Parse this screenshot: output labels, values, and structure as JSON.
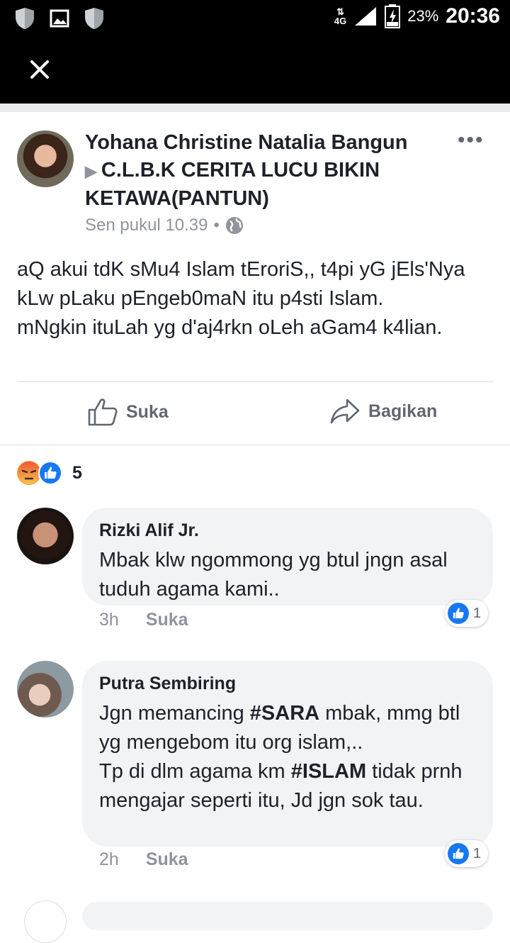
{
  "status_bar": {
    "network": "4G",
    "battery": "23%",
    "time": "20:36"
  },
  "post": {
    "author": "Yohana Christine Natalia Bangun",
    "group": "C.L.B.K CERITA LUCU BIKIN KETAWA(PANTUN)",
    "timestamp": "Sen pukul 10.39",
    "text": "aQ akui tdK sMu4 Islam tEroriS,, t4pi yG jEls'Nya kLw pLaku pEngeb0maN itu p4sti Islam.\nmNgkin ituLah yg d'aj4rkn oLeh aGam4 k4lian.",
    "like_label": "Suka",
    "share_label": "Bagikan",
    "reaction_count": "5"
  },
  "comments": [
    {
      "name": "Rizki Alif Jr.",
      "text": "Mbak klw ngommong yg btul jngn asal tuduh agama kami..",
      "time": "3h",
      "like_label": "Suka",
      "likes": "1"
    },
    {
      "name": "Putra Sembiring",
      "text_parts": [
        "Jgn memancing ",
        "#SARA",
        " mbak, mmg btl yg mengebom itu org islam,..",
        "Tp di dlm agama km ",
        "#ISLAM",
        " tidak prnh mengajar  seperti itu, Jd jgn sok tau."
      ],
      "time": "2h",
      "like_label": "Suka",
      "likes": "1"
    }
  ],
  "colors": {
    "accent": "#1877f2",
    "angry": "#f5a42a",
    "secondary_text": "#90949c"
  }
}
